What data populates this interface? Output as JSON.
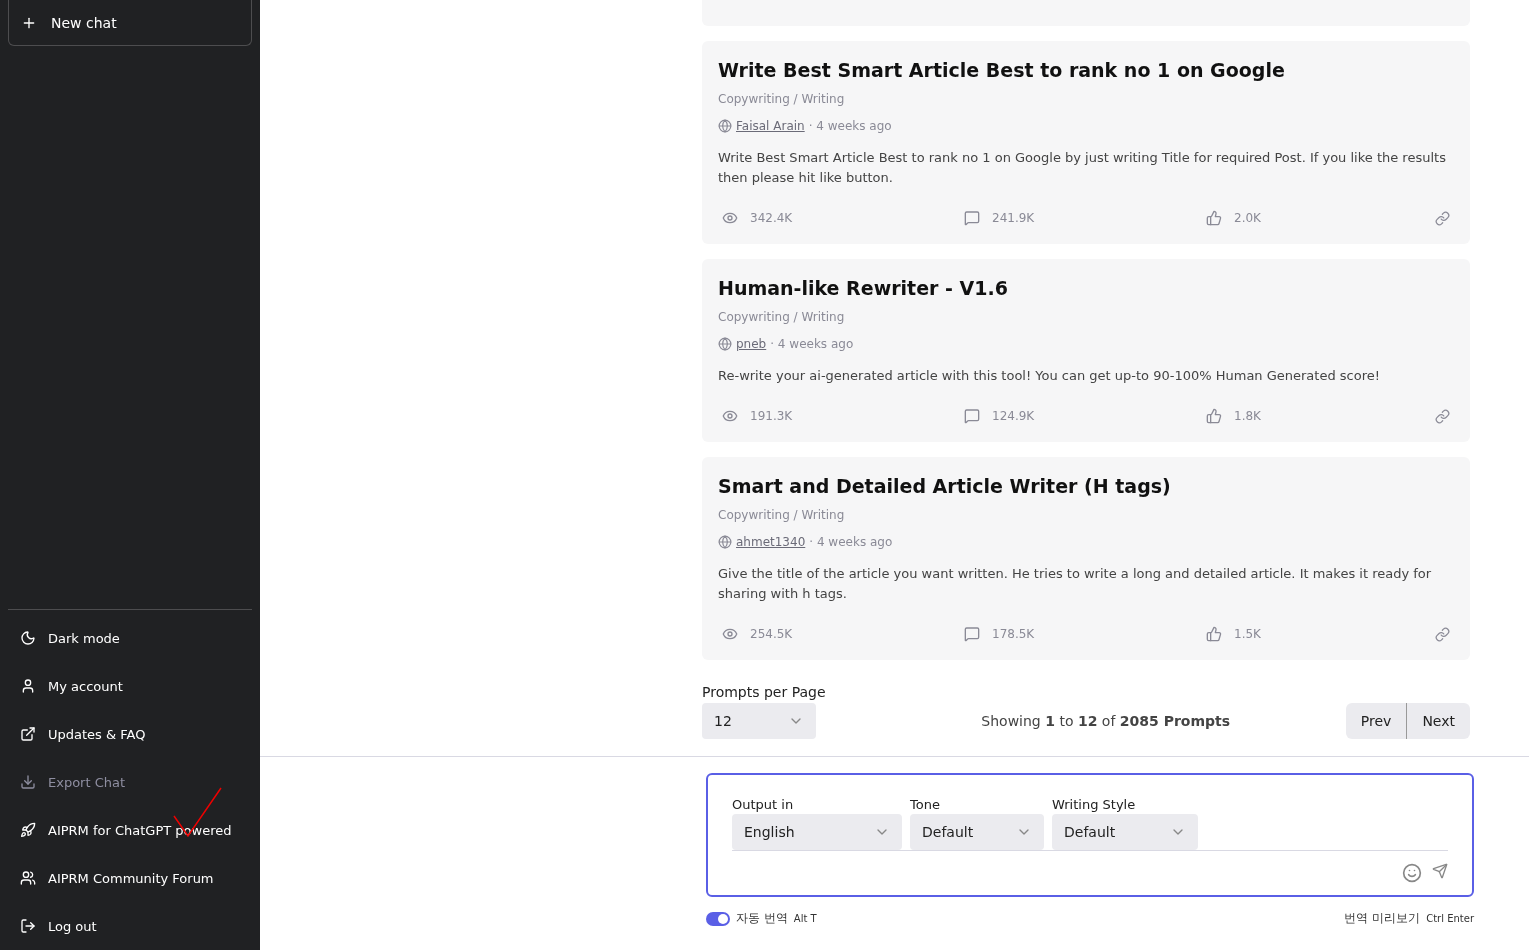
{
  "sidebar": {
    "new_chat": "New chat",
    "items": [
      {
        "label": "Dark mode",
        "disabled": false
      },
      {
        "label": "My account",
        "disabled": false
      },
      {
        "label": "Updates & FAQ",
        "disabled": false
      },
      {
        "label": "Export Chat",
        "disabled": true
      },
      {
        "label": "AIPRM for ChatGPT powered",
        "disabled": false
      },
      {
        "label": "AIPRM Community Forum",
        "disabled": false
      },
      {
        "label": "Log out",
        "disabled": false
      }
    ]
  },
  "cards": [
    {
      "title": "Write Best Smart Article Best to rank no 1 on Google",
      "category": "Copywriting / Writing",
      "author": "Faisal Arain",
      "age": "· 4 weeks ago",
      "description": "Write Best Smart Article Best to rank no 1 on Google by just writing Title for required Post. If you like the results then please hit like button.",
      "views": "342.4K",
      "comments": "241.9K",
      "likes": "2.0K"
    },
    {
      "title": "Human-like Rewriter - V1.6",
      "category": "Copywriting / Writing",
      "author": "pneb",
      "age": "· 4 weeks ago",
      "description": "Re-write your ai-generated article with this tool! You can get up-to 90-100% Human Generated score!",
      "views": "191.3K",
      "comments": "124.9K",
      "likes": "1.8K"
    },
    {
      "title": "Smart and Detailed Article Writer (H tags)",
      "category": "Copywriting / Writing",
      "author": "ahmet1340",
      "age": "· 4 weeks ago",
      "description": "Give the title of the article you want written. He tries to write a long and detailed article. It makes it ready for sharing with h tags.",
      "views": "254.5K",
      "comments": "178.5K",
      "likes": "1.5K"
    }
  ],
  "pagination": {
    "per_page_label": "Prompts per Page",
    "per_page": "12",
    "showing": "Showing **1** to **12** of **2085 Prompts**",
    "prev": "Prev",
    "next": "Next"
  },
  "composer": {
    "selects": [
      {
        "label": "Output in",
        "value": "English"
      },
      {
        "label": "Tone",
        "value": "Default"
      },
      {
        "label": "Writing Style",
        "value": "Default"
      }
    ]
  },
  "translate": {
    "label": "자동 번역",
    "on": true,
    "shortcut": "Alt T",
    "preview": "번역 미리보기",
    "preview_shortcut": "Ctrl Enter"
  }
}
